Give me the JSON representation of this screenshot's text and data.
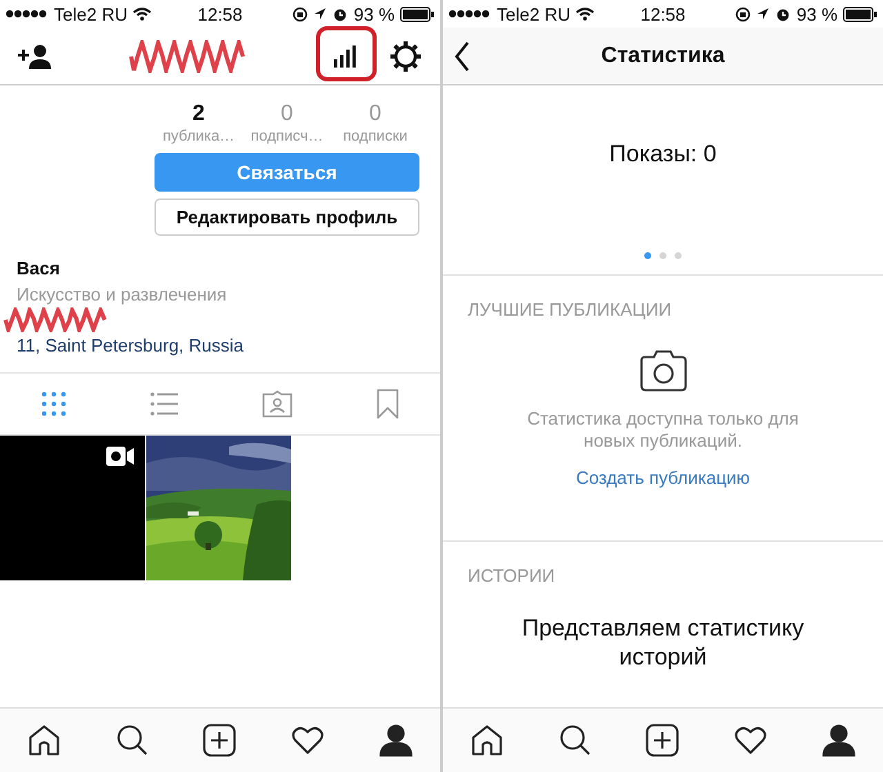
{
  "left_screen": {
    "status_bar": {
      "carrier": "Tele2 RU",
      "time": "12:58",
      "battery": "93 %"
    },
    "nav_actions": [
      {
        "kind": "add-person",
        "highlighted": false
      },
      {
        "kind": "stats",
        "highlighted": true
      },
      {
        "kind": "settings",
        "highlighted": false
      }
    ],
    "stats": [
      {
        "count": "2",
        "label": "публика…",
        "dimmed": false
      },
      {
        "count": "0",
        "label": "подписч…",
        "dimmed": true
      },
      {
        "count": "0",
        "label": "подписки",
        "dimmed": true
      }
    ],
    "contact_button": "Связаться",
    "edit_button": "Редактировать профиль",
    "name": "Вася",
    "category": "Искусство и развлечения",
    "address": "11, Saint Petersburg, Russia",
    "view_tabs": [
      {
        "kind": "grid",
        "selected": true
      },
      {
        "kind": "list",
        "selected": false
      },
      {
        "kind": "tagged",
        "selected": false
      },
      {
        "kind": "saved",
        "selected": false
      }
    ],
    "posts": [
      {
        "kind": "video"
      },
      {
        "kind": "picture"
      }
    ],
    "tab_bar": [
      {
        "kind": "home",
        "selected": false
      },
      {
        "kind": "search",
        "selected": false
      },
      {
        "kind": "add",
        "selected": false
      },
      {
        "kind": "activity",
        "selected": false
      },
      {
        "kind": "profile",
        "selected": true
      }
    ]
  },
  "right_screen": {
    "status_bar": {
      "carrier": "Tele2 RU",
      "time": "12:58",
      "battery": "93 %"
    },
    "title": "Статистика",
    "impressions": "Показы: 0",
    "dots": [
      {
        "selected": true
      },
      {
        "selected": false
      },
      {
        "selected": false
      }
    ],
    "sections": [
      {
        "kind": "top-posts",
        "heading": "ЛУЧШИЕ ПУБЛИКАЦИИ",
        "message": "Статистика доступна только для новых публикаций.",
        "link": "Создать публикацию"
      },
      {
        "kind": "stories",
        "heading": "ИСТОРИИ",
        "message": "Представляем статистику историй"
      }
    ],
    "tab_bar": [
      {
        "kind": "home",
        "selected": false
      },
      {
        "kind": "search",
        "selected": false
      },
      {
        "kind": "add",
        "selected": false
      },
      {
        "kind": "activity",
        "selected": false
      },
      {
        "kind": "profile",
        "selected": true
      }
    ]
  }
}
